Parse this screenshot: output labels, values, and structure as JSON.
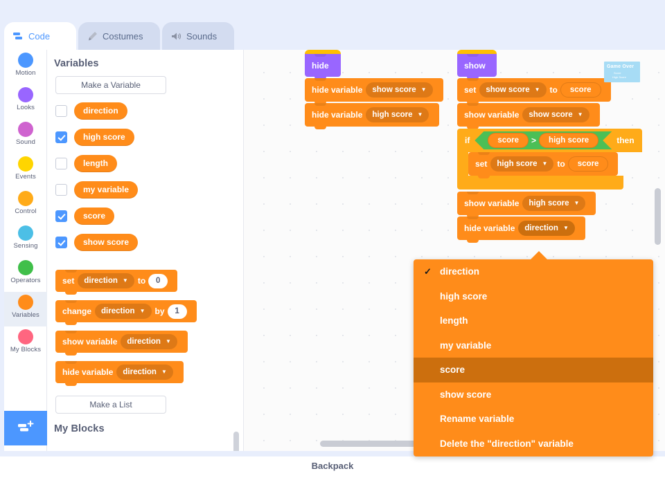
{
  "tabs": [
    {
      "id": "code",
      "label": "Code",
      "icon": "code-icon",
      "active": true
    },
    {
      "id": "costumes",
      "label": "Costumes",
      "icon": "brush-icon",
      "active": false
    },
    {
      "id": "sounds",
      "label": "Sounds",
      "icon": "speaker-icon",
      "active": false
    }
  ],
  "categories": [
    {
      "label": "Motion",
      "color": "#4c97ff",
      "selected": false
    },
    {
      "label": "Looks",
      "color": "#9966ff",
      "selected": false
    },
    {
      "label": "Sound",
      "color": "#cf63cf",
      "selected": false
    },
    {
      "label": "Events",
      "color": "#ffd500",
      "selected": false
    },
    {
      "label": "Control",
      "color": "#ffab19",
      "selected": false
    },
    {
      "label": "Sensing",
      "color": "#4cbfe6",
      "selected": false
    },
    {
      "label": "Operators",
      "color": "#40bf4a",
      "selected": false
    },
    {
      "label": "Variables",
      "color": "#ff8c1a",
      "selected": true
    },
    {
      "label": "My Blocks",
      "color": "#ff6680",
      "selected": false
    }
  ],
  "extension_button": {
    "name": "add-extension-button",
    "icon": "add-extension-icon"
  },
  "palette": {
    "heading": "Variables",
    "make_variable_label": "Make a Variable",
    "make_list_label": "Make a List",
    "next_heading": "My Blocks",
    "variables": [
      {
        "name": "direction",
        "checked": false
      },
      {
        "name": "high score",
        "checked": true
      },
      {
        "name": "length",
        "checked": false
      },
      {
        "name": "my variable",
        "checked": false
      },
      {
        "name": "score",
        "checked": true
      },
      {
        "name": "show score",
        "checked": true
      }
    ],
    "blocks": [
      {
        "type": "set",
        "label": "set",
        "variable": "direction",
        "to_label": "to",
        "value": "0"
      },
      {
        "type": "change",
        "label": "change",
        "variable": "direction",
        "by_label": "by",
        "value": "1"
      },
      {
        "type": "show",
        "label": "show variable",
        "variable": "direction"
      },
      {
        "type": "hide",
        "label": "hide variable",
        "variable": "direction"
      }
    ]
  },
  "canvas": {
    "script_left": {
      "hat": "hide",
      "blocks": [
        {
          "label": "hide variable",
          "variable": "show score"
        },
        {
          "label": "hide variable",
          "variable": "high score"
        }
      ]
    },
    "script_right": {
      "hat": "show",
      "set_label": "set",
      "set_variable": "show score",
      "set_to_label": "to",
      "set_value_reporter": "score",
      "show_variable_label": "show variable",
      "show_variable_name": "show score",
      "if_label": "if",
      "then_label": "then",
      "condition_left": "score",
      "condition_operator": ">",
      "condition_right": "high score",
      "inner_set_label": "set",
      "inner_set_variable": "high score",
      "inner_set_to_label": "to",
      "inner_set_value": "score",
      "after_show_label": "show variable",
      "after_show_variable": "high score",
      "after_hide_label": "hide variable",
      "after_hide_variable": "direction"
    },
    "sprite_thumb": {
      "line1": "Game Over",
      "line2": "Score",
      "line3": "High Score"
    }
  },
  "dropdown_menu": {
    "items": [
      {
        "label": "direction",
        "checked": true,
        "highlighted": false
      },
      {
        "label": "high score",
        "checked": false,
        "highlighted": false
      },
      {
        "label": "length",
        "checked": false,
        "highlighted": false
      },
      {
        "label": "my variable",
        "checked": false,
        "highlighted": false
      },
      {
        "label": "score",
        "checked": false,
        "highlighted": true
      },
      {
        "label": "show score",
        "checked": false,
        "highlighted": false
      },
      {
        "label": "Rename variable",
        "checked": false,
        "highlighted": false
      },
      {
        "label": "Delete the \"direction\" variable",
        "checked": false,
        "highlighted": false
      }
    ],
    "checkmark": "✓"
  },
  "bottom": {
    "backpack_label": "Backpack"
  },
  "colors": {
    "variables": "#ff8c1a",
    "control": "#ffab19",
    "looks": "#9966ff",
    "operators": "#4cbf56",
    "accent": "#4c97ff",
    "menu_highlight": "#cc6f0e"
  }
}
